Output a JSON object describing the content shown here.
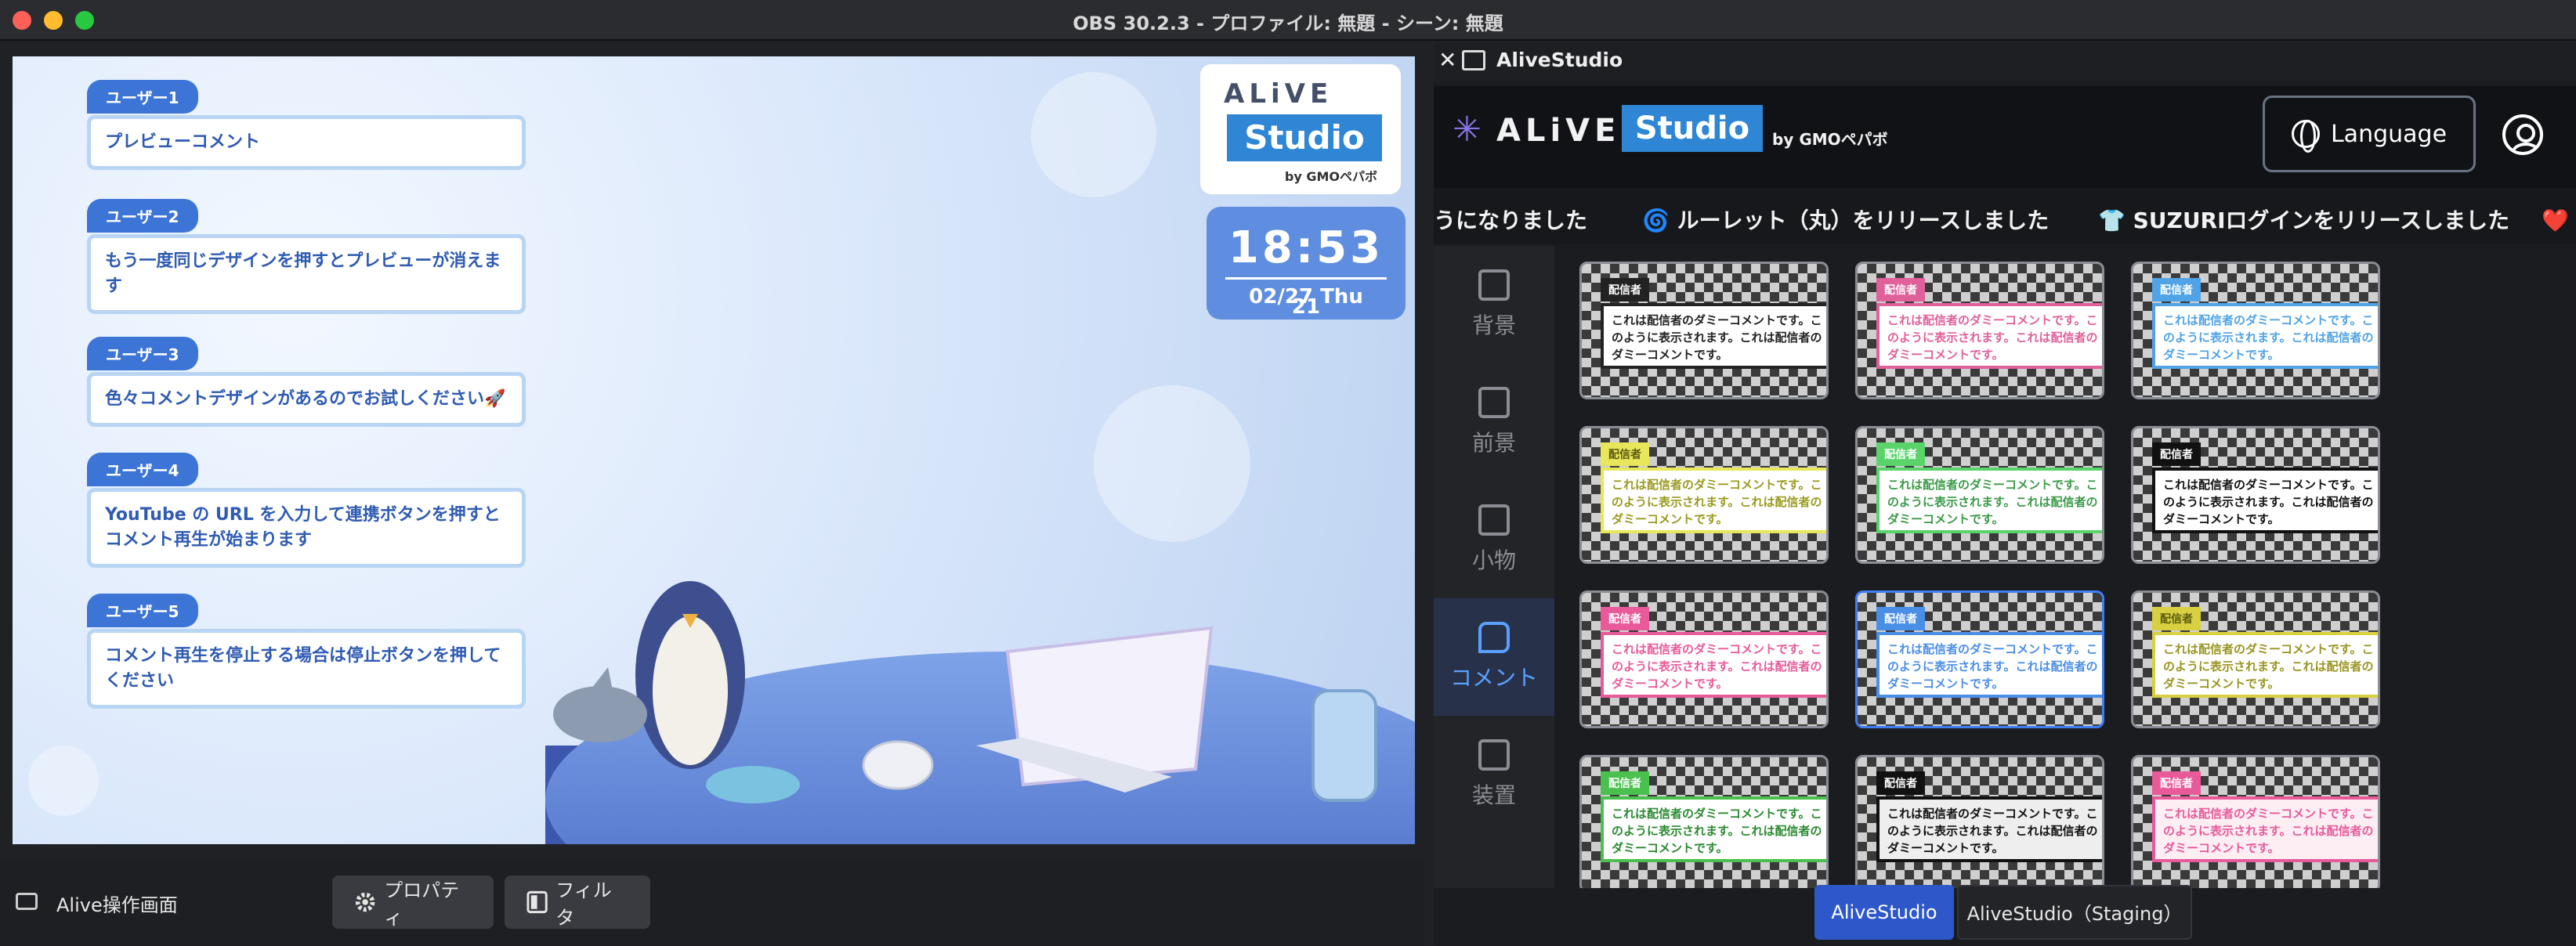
{
  "window": {
    "title": "OBS 30.2.3 - プロファイル: 無題 - シーン: 無題"
  },
  "preview": {
    "comments": [
      {
        "user": "ユーザー1",
        "text": "プレビューコメント"
      },
      {
        "user": "ユーザー2",
        "text": "もう一度同じデザインを押すとプレビューが消えます"
      },
      {
        "user": "ユーザー3",
        "text": "色々コメントデザインがあるのでお試しください🚀"
      },
      {
        "user": "ユーザー4",
        "text": "YouTube の URL を入力して連携ボタンを押すとコメント再生が始まります"
      },
      {
        "user": "ユーザー5",
        "text": "コメント再生を停止する場合は停止ボタンを押してください"
      }
    ],
    "logo": {
      "alive": "ALiVE",
      "studio": "Studio",
      "by": "by GMOペパボ"
    },
    "clock": {
      "time": "18:53",
      "seconds": "21",
      "date": "02/27 Thu"
    }
  },
  "sources": {
    "selected_source": "Alive操作画面",
    "properties_label": "プロパティ",
    "filters_label": "フィルタ"
  },
  "dock": {
    "title": "AliveStudio",
    "brand": {
      "alive": "ALiVE",
      "studio": "Studio",
      "by": "by GMOペパボ"
    },
    "language_label": "Language",
    "ticker": [
      "うになりました",
      "🌀 ルーレット（丸）をリリースしました",
      "👕 SUZURIログインをリリースしました",
      "❤️ ス"
    ],
    "sidebar": [
      {
        "label": "背景",
        "icon": "image-icon"
      },
      {
        "label": "前景",
        "icon": "image-plus-icon"
      },
      {
        "label": "小物",
        "icon": "cup-icon"
      },
      {
        "label": "コメント",
        "icon": "comment-icon",
        "active": true
      },
      {
        "label": "装置",
        "icon": "widgets-icon"
      }
    ],
    "tile_tag": "配信者",
    "tile_text": "これは配信者のダミーコメントです。このように表示されます。これは配信者のダミーコメントです。",
    "tiles": [
      {
        "accent": "#222222",
        "bg": "#ffffff",
        "text_color": "#222222"
      },
      {
        "accent": "#e0609a",
        "bg": "#ffffff",
        "text_color": "#e0609a"
      },
      {
        "accent": "#4fa3e6",
        "bg": "#ffffff",
        "text_color": "#4fa3e6"
      },
      {
        "accent": "#e8e65a",
        "bg": "#ffffff",
        "text_color": "#9a9a20"
      },
      {
        "accent": "#5ad46a",
        "bg": "#ffffff",
        "text_color": "#3a9a48"
      },
      {
        "accent": "#111111",
        "bg": "#ffffff",
        "text_color": "#111111"
      },
      {
        "accent": "#e85a9a",
        "bg": "#ffffff",
        "text_color": "#e85a9a"
      },
      {
        "accent": "#4a8ee6",
        "bg": "#ffffff",
        "text_color": "#4a8ee6",
        "selected": true
      },
      {
        "accent": "#d8d040",
        "bg": "#ffffff",
        "text_color": "#9a9420"
      },
      {
        "accent": "#4ac04e",
        "bg": "#ffffff",
        "text_color": "#2a8a30"
      },
      {
        "accent": "#111111",
        "bg": "#eeeeee",
        "text_color": "#111111"
      },
      {
        "accent": "#e85a9a",
        "bg": "#fdeef4",
        "text_color": "#e85a9a"
      }
    ],
    "tabs": [
      {
        "label": "AliveStudio",
        "active": true
      },
      {
        "label": "AliveStudio（Staging）",
        "active": false
      }
    ]
  }
}
